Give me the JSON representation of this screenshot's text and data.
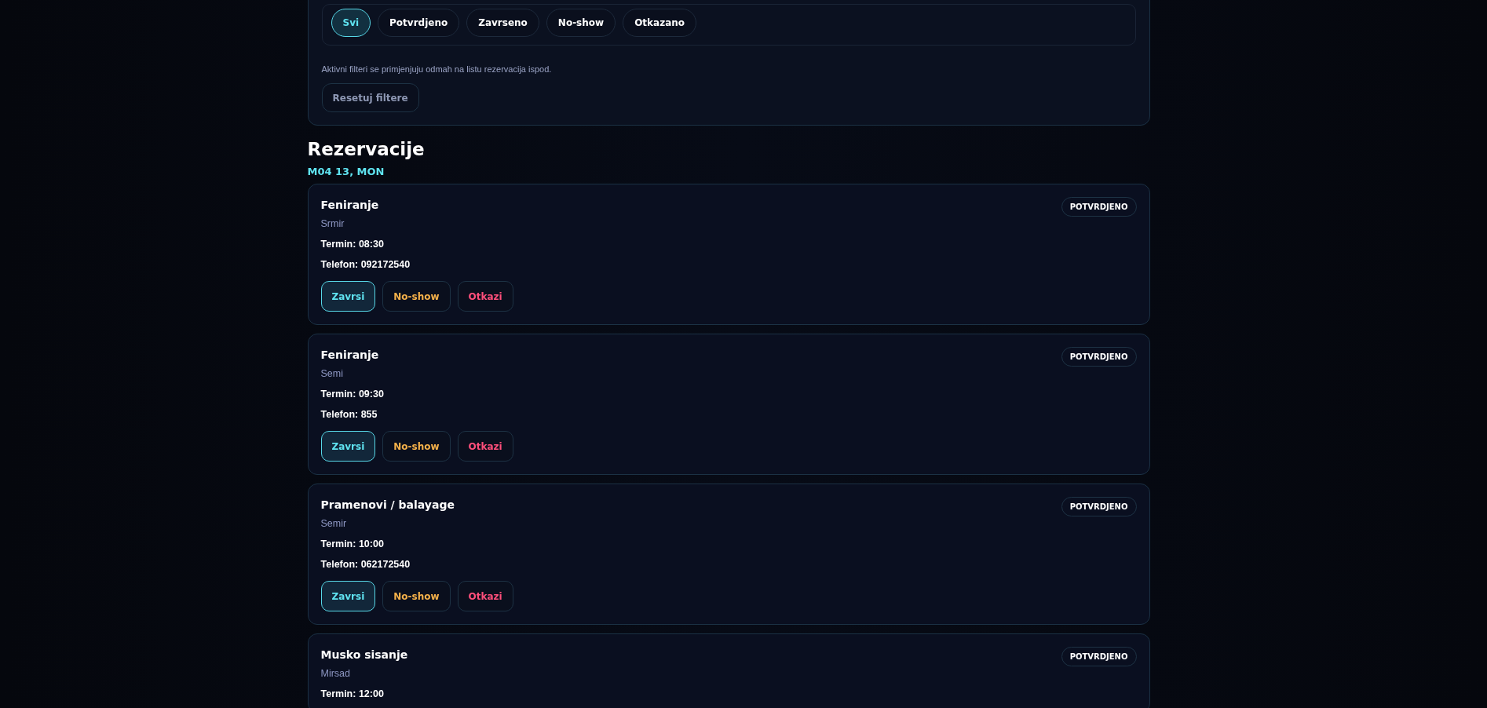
{
  "filters": {
    "chips": [
      {
        "label": "Svi",
        "selected": true
      },
      {
        "label": "Potvrdjeno",
        "selected": false
      },
      {
        "label": "Zavrseno",
        "selected": false
      },
      {
        "label": "No-show",
        "selected": false
      },
      {
        "label": "Otkazano",
        "selected": false
      }
    ],
    "hint": "Aktivni filteri se primjenjuju odmah na listu rezervacija ispod.",
    "reset_button": "Resetuj filtere"
  },
  "section_title": "Rezervacije",
  "date_heading": "M04 13, MON",
  "reservations": [
    {
      "service": "Feniranje",
      "client": "Srmir",
      "time": "Termin: 08:30",
      "phone": "Telefon: 092172540",
      "status": "POTVRDJENO",
      "actions": [
        {
          "label": "Zavrsi",
          "kind": "complete"
        },
        {
          "label": "No-show",
          "kind": "noshow"
        },
        {
          "label": "Otkazi",
          "kind": "cancel"
        }
      ]
    },
    {
      "service": "Feniranje",
      "client": "Semi",
      "time": "Termin: 09:30",
      "phone": "Telefon: 855",
      "status": "POTVRDJENO",
      "actions": [
        {
          "label": "Zavrsi",
          "kind": "complete"
        },
        {
          "label": "No-show",
          "kind": "noshow"
        },
        {
          "label": "Otkazi",
          "kind": "cancel"
        }
      ]
    },
    {
      "service": "Pramenovi / balayage",
      "client": "Semir",
      "time": "Termin: 10:00",
      "phone": "Telefon: 062172540",
      "status": "POTVRDJENO",
      "actions": [
        {
          "label": "Zavrsi",
          "kind": "complete"
        },
        {
          "label": "No-show",
          "kind": "noshow"
        },
        {
          "label": "Otkazi",
          "kind": "cancel"
        }
      ]
    },
    {
      "service": "Musko sisanje",
      "client": "Mirsad",
      "time": "Termin: 12:00",
      "status": "POTVRDJENO"
    }
  ]
}
